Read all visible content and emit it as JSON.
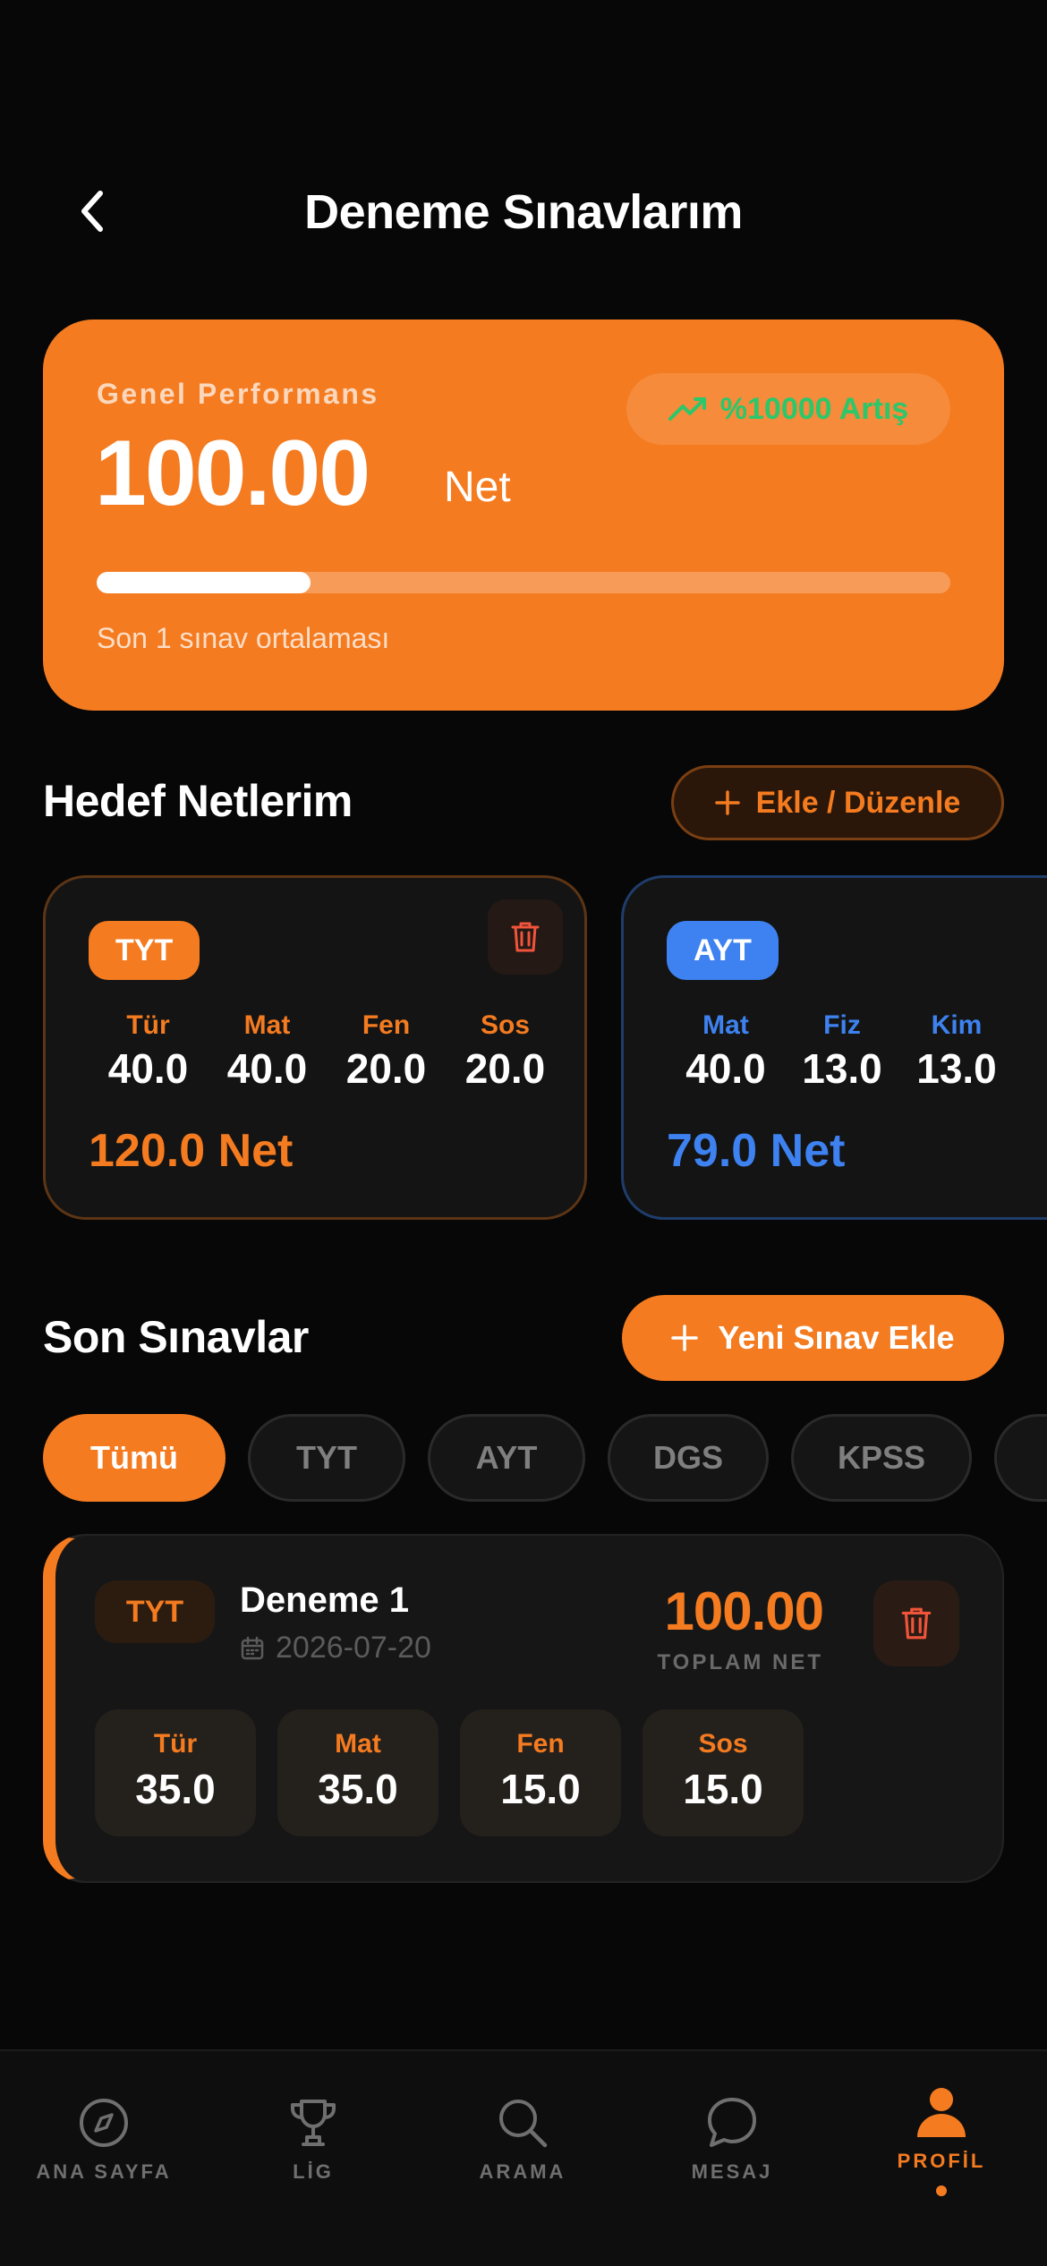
{
  "header": {
    "title": "Deneme Sınavlarım"
  },
  "performance": {
    "label": "Genel Performans",
    "value": "100.00",
    "unit": "Net",
    "badge": "%10000 Artış",
    "progress_percent": 25,
    "caption": "Son 1 sınav ortalaması"
  },
  "goals": {
    "title": "Hedef Netlerim",
    "edit_button": "Ekle / Düzenle",
    "cards": [
      {
        "type": "TYT",
        "accent": "#f47b20",
        "subjects": [
          {
            "label": "Tür",
            "value": "40.0"
          },
          {
            "label": "Mat",
            "value": "40.0"
          },
          {
            "label": "Fen",
            "value": "20.0"
          },
          {
            "label": "Sos",
            "value": "20.0"
          }
        ],
        "total": "120.0 Net"
      },
      {
        "type": "AYT",
        "accent": "#3d82f0",
        "subjects": [
          {
            "label": "Mat",
            "value": "40.0"
          },
          {
            "label": "Fiz",
            "value": "13.0"
          },
          {
            "label": "Kim",
            "value": "13.0"
          }
        ],
        "total": "79.0 Net"
      }
    ]
  },
  "recent": {
    "title": "Son Sınavlar",
    "add_button": "Yeni Sınav Ekle",
    "filters": [
      "Tümü",
      "TYT",
      "AYT",
      "DGS",
      "KPSS"
    ],
    "active_filter": "Tümü",
    "exams": [
      {
        "type": "TYT",
        "name": "Deneme 1",
        "date": "2026-07-20",
        "net": "100.00",
        "net_label": "TOPLAM NET",
        "subjects": [
          {
            "label": "Tür",
            "value": "35.0"
          },
          {
            "label": "Mat",
            "value": "35.0"
          },
          {
            "label": "Fen",
            "value": "15.0"
          },
          {
            "label": "Sos",
            "value": "15.0"
          }
        ]
      }
    ]
  },
  "tabbar": {
    "items": [
      {
        "label": "ANA SAYFA",
        "icon": "compass-icon"
      },
      {
        "label": "LİG",
        "icon": "trophy-icon"
      },
      {
        "label": "ARAMA",
        "icon": "search-icon"
      },
      {
        "label": "MESAJ",
        "icon": "chat-bubble-icon"
      },
      {
        "label": "PROFİL",
        "icon": "user-icon"
      }
    ],
    "active": "PROFİL"
  },
  "colors": {
    "accent": "#f47b20",
    "ayt_blue": "#3d82f0",
    "success": "#2bc76a",
    "danger": "#f0543a",
    "background": "#070707"
  }
}
